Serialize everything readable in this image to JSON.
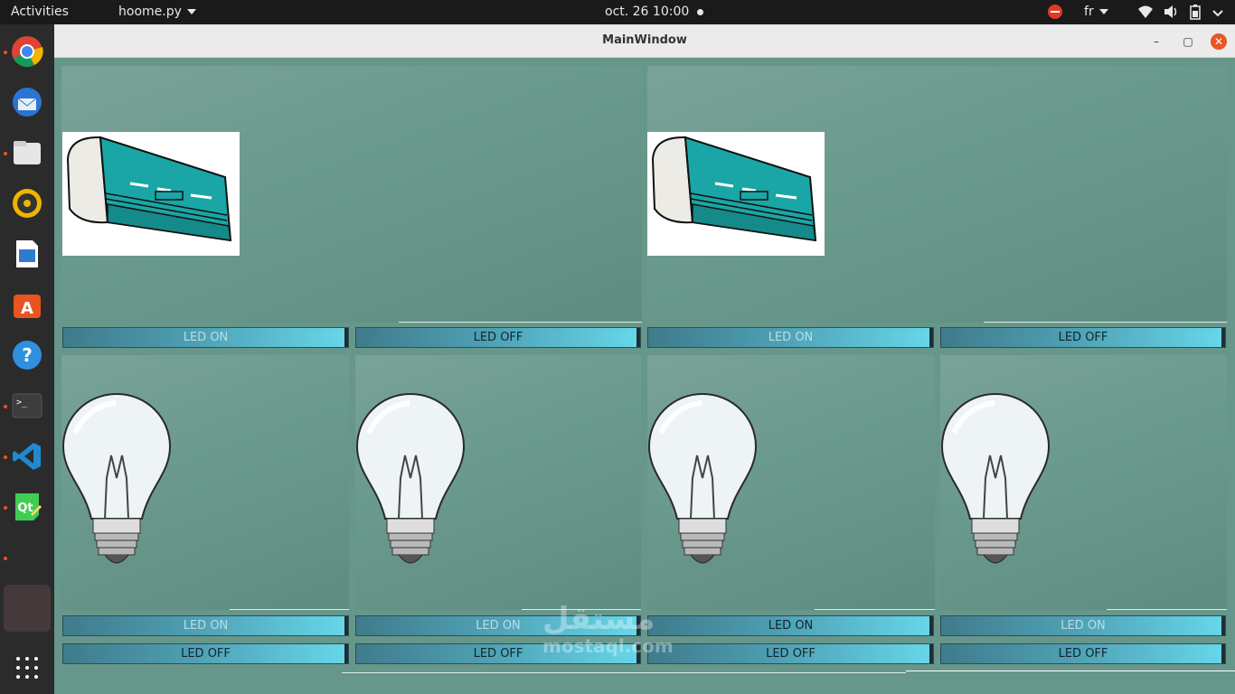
{
  "topbar": {
    "activities": "Activities",
    "app_name": "hoome.py",
    "clock": "oct. 26  10:00",
    "lang": "fr"
  },
  "dock": {
    "icons": [
      "chrome-icon",
      "thunderbird-icon",
      "files-icon",
      "rhythmbox-icon",
      "writer-icon",
      "software-icon",
      "help-icon",
      "terminal-icon",
      "vscode-icon",
      "qtcreator-icon"
    ]
  },
  "window": {
    "title": "MainWindow",
    "minimize": "–",
    "maximize": "▢",
    "close": "✕"
  },
  "ac_panels": [
    {
      "btn_on": "LED ON",
      "btn_off": "LED OFF"
    },
    {
      "btn_on": "LED ON",
      "btn_off": "LED OFF"
    }
  ],
  "lamp_panels": [
    {
      "btn_on": "LED ON",
      "btn_off": "LED OFF"
    },
    {
      "btn_on": "LED ON",
      "btn_off": "LED OFF"
    },
    {
      "btn_on": "LED ON",
      "btn_off": "LED OFF"
    },
    {
      "btn_on": "LED ON",
      "btn_off": "LED OFF"
    }
  ],
  "watermark": {
    "arabic": "مستقل",
    "latin": "mostaql.com"
  },
  "colors": {
    "accent_orange": "#e95420",
    "panel_bg": "#67968a",
    "button_cyan": "#67d7ea",
    "ac_body": "#1aa6a6"
  }
}
